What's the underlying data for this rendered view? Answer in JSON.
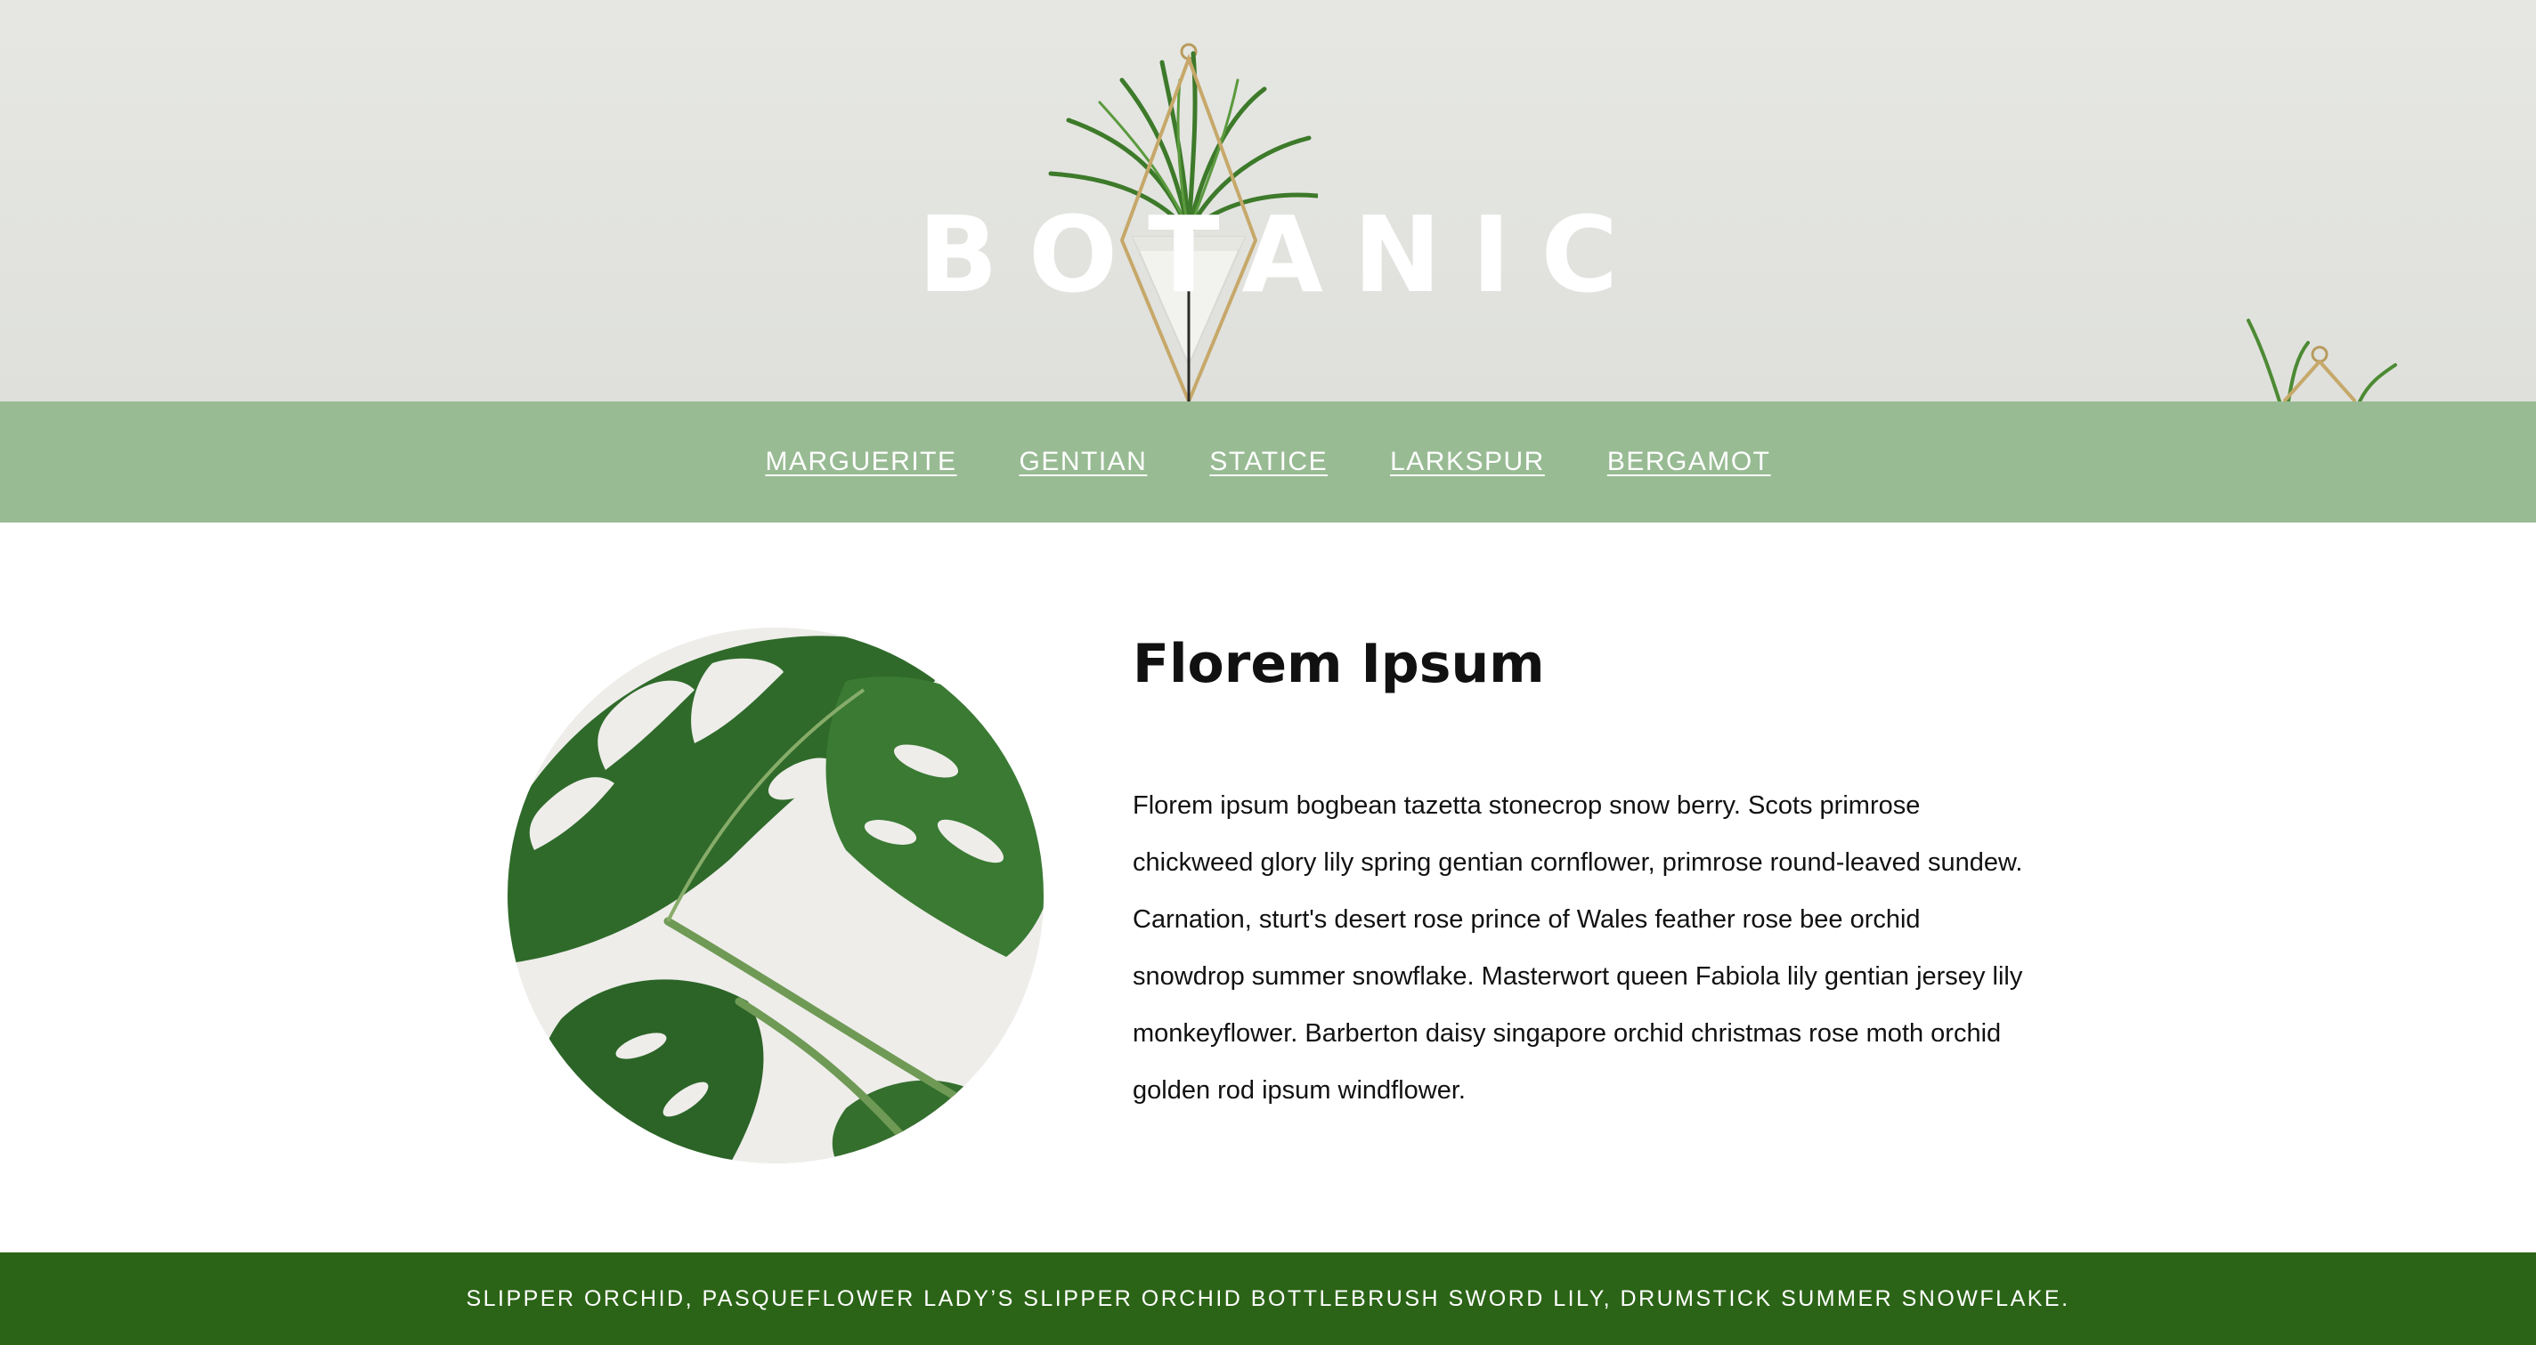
{
  "header": {
    "title": "BOTANIC"
  },
  "nav": {
    "items": [
      {
        "label": "MARGUERITE"
      },
      {
        "label": "GENTIAN"
      },
      {
        "label": "STATICE"
      },
      {
        "label": "LARKSPUR"
      },
      {
        "label": "BERGAMOT"
      }
    ]
  },
  "main": {
    "heading": "Florem Ipsum",
    "body": "Florem ipsum bogbean tazetta stonecrop snow berry. Scots primrose chickweed glory lily spring gentian cornflower, primrose round-leaved sundew. Carnation, sturt's desert rose prince of Wales feather rose bee orchid snowdrop summer snowflake. Masterwort queen Fabiola lily gentian jersey lily monkeyflower. Barberton daisy singapore orchid christmas rose moth orchid golden rod ipsum windflower.",
    "image_icon": "monstera-leaf-image"
  },
  "footer": {
    "text": "SLIPPER ORCHID, PASQUEFLOWER LADY’S SLIPPER ORCHID BOTTLEBRUSH SWORD LILY, DRUMSTICK SUMMER SNOWFLAKE."
  },
  "colors": {
    "hero_bg": "#e3e4e0",
    "nav_bg": "#98bb93",
    "footer_bg": "#2b6416",
    "text": "#111111",
    "title_text": "#ffffff"
  }
}
